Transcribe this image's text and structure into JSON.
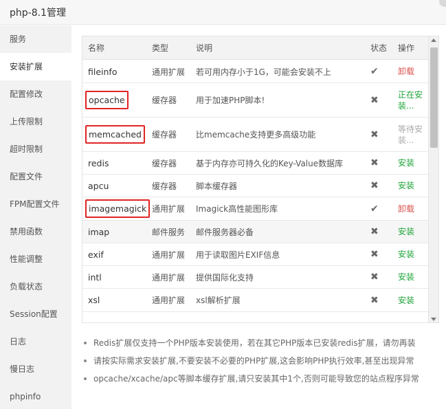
{
  "window": {
    "title": "php-8.1管理"
  },
  "sidebar": {
    "active_index": 1,
    "items": [
      {
        "label": "服务"
      },
      {
        "label": "安装扩展"
      },
      {
        "label": "配置修改"
      },
      {
        "label": "上传限制"
      },
      {
        "label": "超时限制"
      },
      {
        "label": "配置文件"
      },
      {
        "label": "FPM配置文件"
      },
      {
        "label": "禁用函数"
      },
      {
        "label": "性能调整"
      },
      {
        "label": "负载状态"
      },
      {
        "label": "Session配置"
      },
      {
        "label": "日志"
      },
      {
        "label": "慢日志"
      },
      {
        "label": "phpinfo"
      }
    ]
  },
  "table": {
    "columns": {
      "name": "名称",
      "type": "类型",
      "desc": "说明",
      "status": "状态",
      "action": "操作"
    },
    "status_icons": {
      "installed": "✔",
      "not_installed": "✖"
    },
    "rows": [
      {
        "name": "fileinfo",
        "type": "通用扩展",
        "desc": "若可用内存小于1G，可能会安装不上",
        "status": "installed",
        "action": "卸载",
        "action_kind": "uninstall",
        "highlight": false,
        "shaded": false
      },
      {
        "name": "opcache",
        "type": "缓存器",
        "desc": "用于加速PHP脚本!",
        "status": "not_installed",
        "action": "正在安装...",
        "action_kind": "running",
        "highlight": true,
        "shaded": false,
        "tall": true
      },
      {
        "name": "memcached",
        "type": "缓存器",
        "desc": "比memcache支持更多高级功能",
        "status": "not_installed",
        "action": "等待安装...",
        "action_kind": "waiting",
        "highlight": true,
        "shaded": false,
        "tall": true
      },
      {
        "name": "redis",
        "type": "缓存器",
        "desc": "基于内存亦可持久化的Key-Value数据库",
        "status": "not_installed",
        "action": "安装",
        "action_kind": "install",
        "highlight": false,
        "shaded": false
      },
      {
        "name": "apcu",
        "type": "缓存器",
        "desc": "脚本缓存器",
        "status": "not_installed",
        "action": "安装",
        "action_kind": "install",
        "highlight": false,
        "shaded": false
      },
      {
        "name": "imagemagick",
        "type": "通用扩展",
        "desc": "Imagick高性能图形库",
        "status": "installed",
        "action": "卸载",
        "action_kind": "uninstall",
        "highlight": true,
        "shaded": false
      },
      {
        "name": "imap",
        "type": "邮件服务",
        "desc": "邮件服务器必备",
        "status": "not_installed",
        "action": "安装",
        "action_kind": "install",
        "highlight": false,
        "shaded": true
      },
      {
        "name": "exif",
        "type": "通用扩展",
        "desc": "用于读取图片EXIF信息",
        "status": "not_installed",
        "action": "安装",
        "action_kind": "install",
        "highlight": false,
        "shaded": false
      },
      {
        "name": "intl",
        "type": "通用扩展",
        "desc": "提供国际化支持",
        "status": "not_installed",
        "action": "安装",
        "action_kind": "install",
        "highlight": false,
        "shaded": false
      },
      {
        "name": "xsl",
        "type": "通用扩展",
        "desc": "xsl解析扩展",
        "status": "not_installed",
        "action": "安装",
        "action_kind": "install",
        "highlight": false,
        "shaded": false
      }
    ]
  },
  "notes": [
    "Redis扩展仅支持一个PHP版本安装使用，若在其它PHP版本已安装redis扩展，请勿再装",
    "请按实际需求安装扩展,不要安装不必要的PHP扩展,这会影响PHP执行效率,甚至出现异常",
    "opcache/xcache/apc等脚本缓存扩展,请只安装其中1个,否则可能导致您的站点程序异常"
  ],
  "colors": {
    "install": "#20a53a",
    "uninstall": "#d9534f",
    "waiting": "#aaaaaa",
    "highlight_border": "#e02424"
  }
}
